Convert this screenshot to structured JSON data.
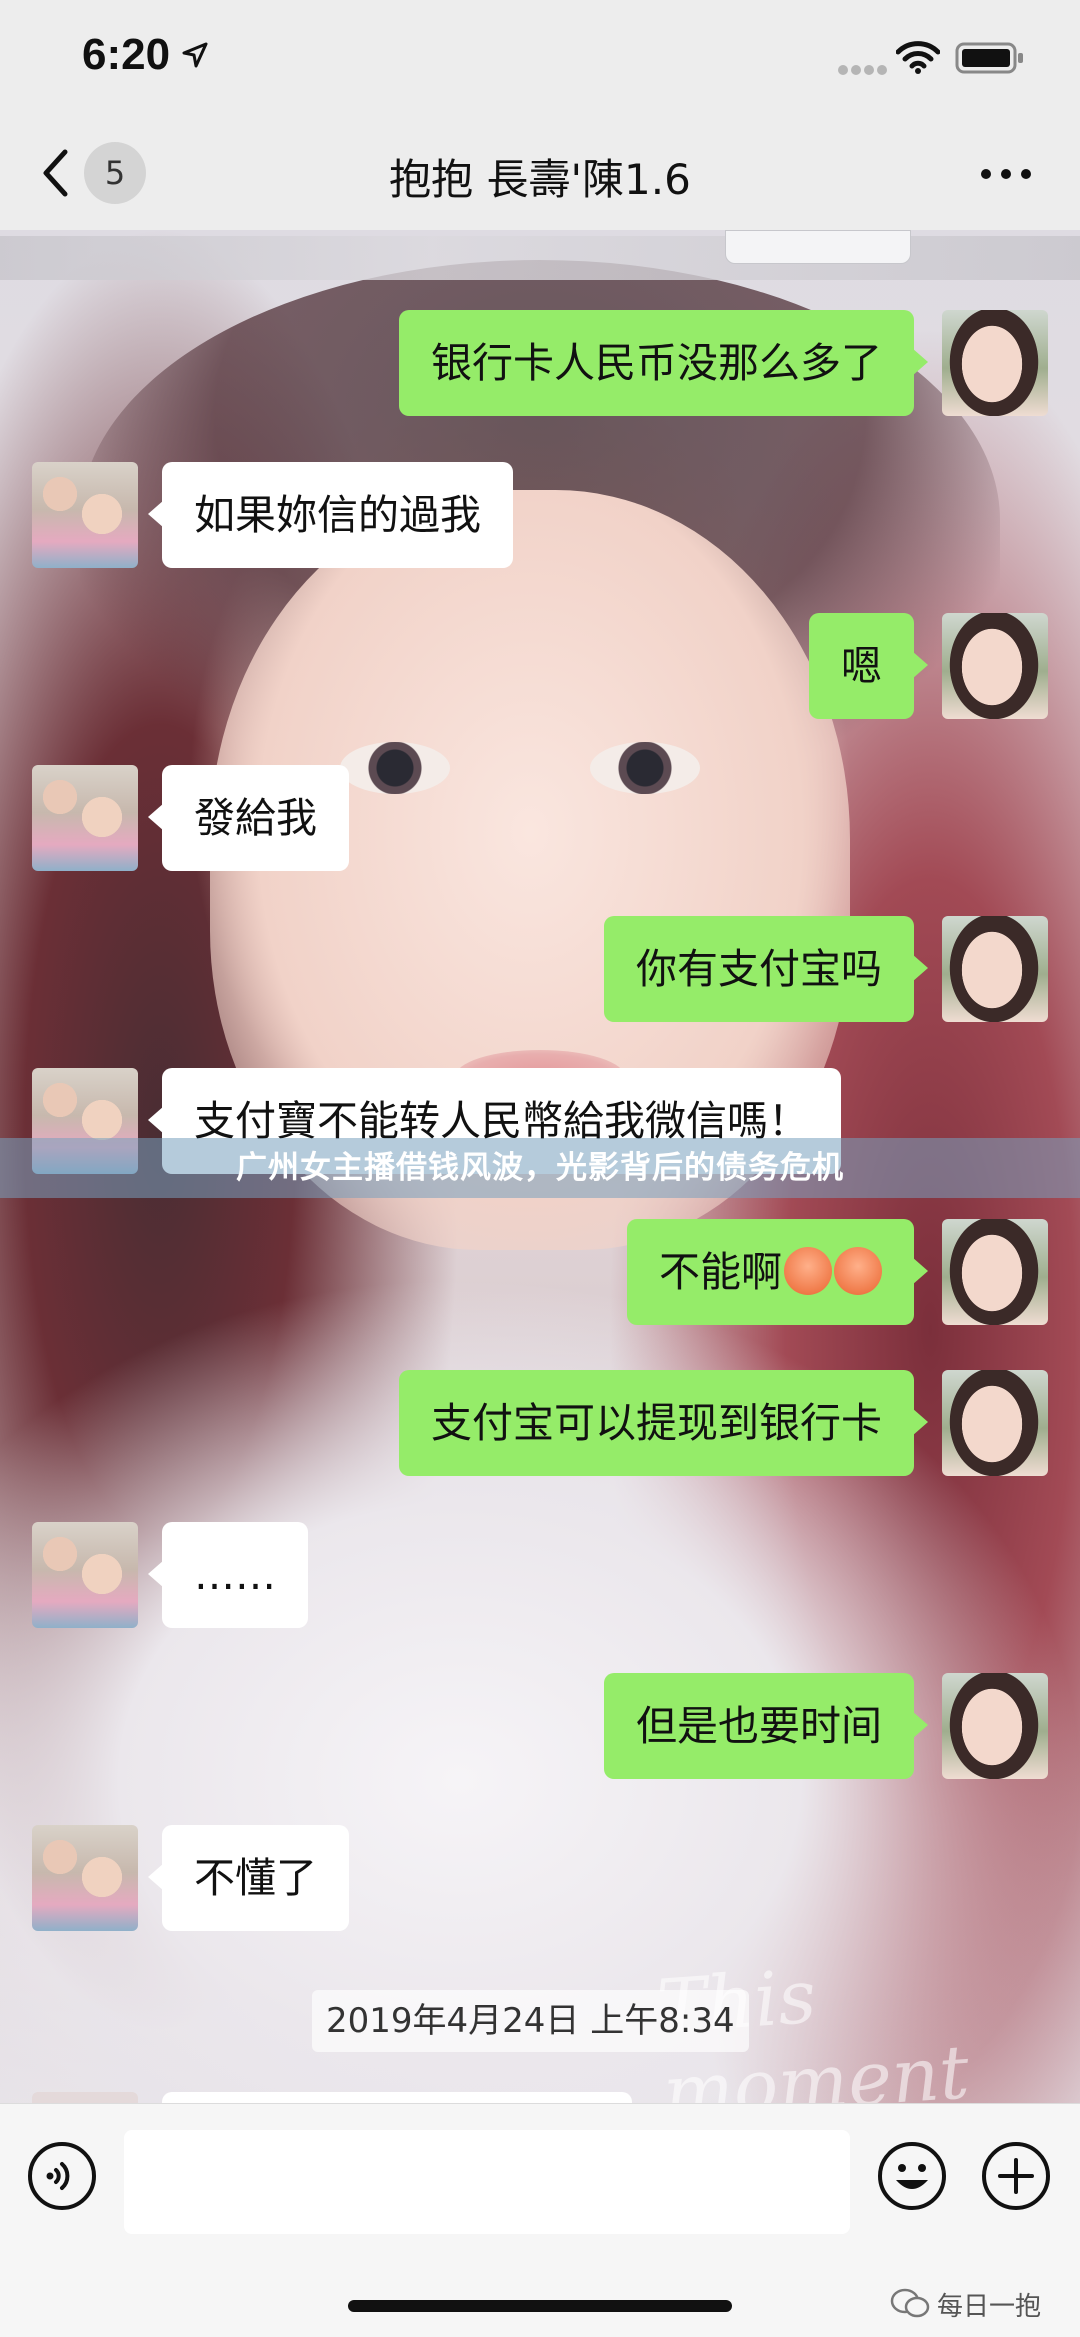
{
  "status_bar": {
    "time": "6:20"
  },
  "header": {
    "unread_count": "5",
    "title": "抱抱 長壽'陳1.6"
  },
  "messages": [
    {
      "side": "me",
      "text": "银行卡人民币没那么多了"
    },
    {
      "side": "them",
      "text": "如果妳信的過我"
    },
    {
      "side": "me",
      "text": "嗯"
    },
    {
      "side": "them",
      "text": "發給我"
    },
    {
      "side": "me",
      "text": "你有支付宝吗"
    },
    {
      "side": "them",
      "text": "支付寶不能转人民幣給我微信嗎！"
    },
    {
      "side": "me",
      "text": "不能啊",
      "emoji_count": 2
    },
    {
      "side": "me",
      "text": "支付宝可以提现到银行卡"
    },
    {
      "side": "them",
      "text": "……"
    },
    {
      "side": "me",
      "text": "但是也要时间"
    },
    {
      "side": "them",
      "text": "不懂了"
    }
  ],
  "timestamp_divider": "2019年4月24日 上午8:34",
  "headline_overlay": "广州女主播借钱风波，光影背后的债务危机",
  "background_watermark": "This moment",
  "input": {
    "value": "",
    "placeholder": ""
  },
  "source_watermark": "每日一抱",
  "icons": {
    "back": "chevron-left-icon",
    "more": "more-dots-icon",
    "voice": "voice-icon",
    "emoji": "emoji-face-icon",
    "plus": "plus-icon"
  },
  "colors": {
    "my_bubble": "#95ec69",
    "their_bubble": "#ffffff",
    "header_bg": "#ededed",
    "input_bar_bg": "#f6f6f6"
  }
}
